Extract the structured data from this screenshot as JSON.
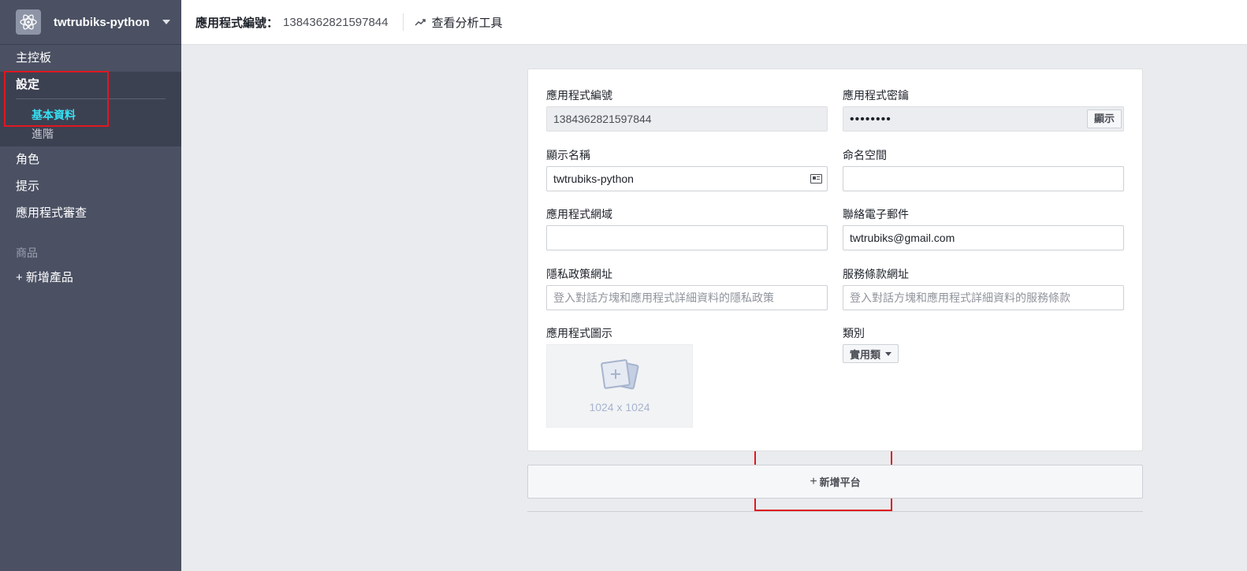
{
  "sidebar": {
    "app_name": "twtrubiks-python",
    "items": {
      "dashboard": "主控板",
      "settings": "設定",
      "settings_basic": "基本資料",
      "settings_advanced": "進階",
      "roles": "角色",
      "alerts": "提示",
      "app_review": "應用程式審查"
    },
    "products_title": "商品",
    "add_product": "+ 新增產品"
  },
  "topbar": {
    "app_id_label": "應用程式編號：",
    "app_id_value": "1384362821597844",
    "analytics_link": "查看分析工具"
  },
  "form": {
    "app_id": {
      "label": "應用程式編號",
      "value": "1384362821597844"
    },
    "app_secret": {
      "label": "應用程式密鑰",
      "value": "••••••••",
      "show_button": "顯示"
    },
    "display_name": {
      "label": "顯示名稱",
      "value": "twtrubiks-python"
    },
    "namespace": {
      "label": "命名空間",
      "value": ""
    },
    "app_domains": {
      "label": "應用程式網域",
      "value": ""
    },
    "contact_email": {
      "label": "聯絡電子郵件",
      "value": "twtrubiks@gmail.com"
    },
    "privacy_url": {
      "label": "隱私政策網址",
      "placeholder": "登入對話方塊和應用程式詳細資料的隱私政策"
    },
    "tos_url": {
      "label": "服務條款網址",
      "placeholder": "登入對話方塊和應用程式詳細資料的服務條款"
    },
    "app_icon": {
      "label": "應用程式圖示",
      "size": "1024 x 1024"
    },
    "category": {
      "label": "類別",
      "value": "實用類"
    }
  },
  "add_platform": {
    "plus": "+",
    "label": "新增平台"
  },
  "colors": {
    "sidebar_bg": "#4b5163",
    "active_link": "#36e0f2",
    "annotation_red": "#e0171f"
  }
}
